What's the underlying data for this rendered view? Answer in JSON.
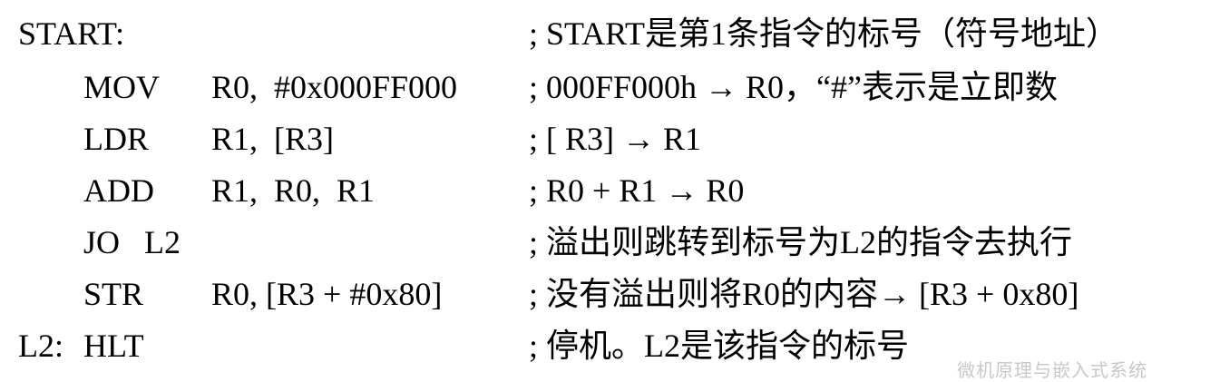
{
  "lines": [
    {
      "label": "START:",
      "mnemonic": "",
      "operands": "",
      "comment": "; START是第1条指令的标号（符号地址）"
    },
    {
      "label": "",
      "mnemonic": "MOV",
      "operands": "R0,  #0x000FF000",
      "comment": "; 000FF000h → R0，“#”表示是立即数"
    },
    {
      "label": "",
      "mnemonic": "LDR",
      "operands": "R1,  [R3]",
      "comment": "; [ R3] → R1"
    },
    {
      "label": "",
      "mnemonic": "ADD",
      "operands": "R1,  R0,  R1",
      "comment": "; R0 + R1 → R0"
    },
    {
      "label": "",
      "mnemonic": "JO   L2",
      "operands": "",
      "comment": "; 溢出则跳转到标号为L2的指令去执行"
    },
    {
      "label": "",
      "mnemonic": "STR",
      "operands": "R0, [R3 + #0x80]",
      "comment": "; 没有溢出则将R0的内容→ [R3 + 0x80]"
    },
    {
      "label": "L2:",
      "mnemonic": "HLT",
      "operands": "",
      "comment": "; 停机。L2是该指令的标号"
    }
  ],
  "watermark": "微机原理与嵌入式系统"
}
